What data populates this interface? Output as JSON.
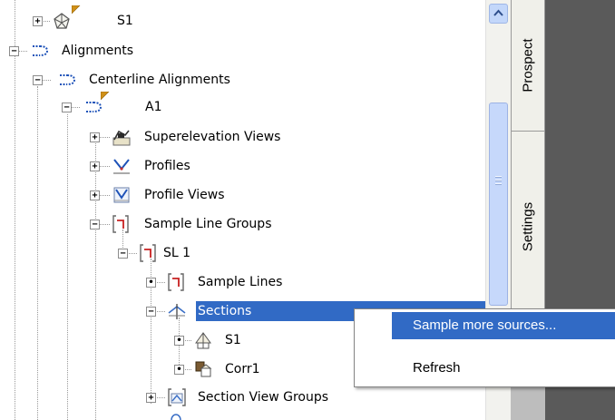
{
  "tree": {
    "items": [
      {
        "label": "S1",
        "icon": "surface-icon",
        "expander": "+"
      },
      {
        "label": "Alignments",
        "icon": "alignment-icon",
        "expander": "−"
      },
      {
        "label": "Centerline Alignments",
        "icon": "alignment-icon",
        "expander": "−"
      },
      {
        "label": "A1",
        "icon": "alignment-icon",
        "expander": "−"
      },
      {
        "label": "Superelevation Views",
        "icon": "superelevation-view-icon",
        "expander": "+"
      },
      {
        "label": "Profiles",
        "icon": "profile-icon",
        "expander": "+"
      },
      {
        "label": "Profile Views",
        "icon": "profile-view-icon",
        "expander": "+"
      },
      {
        "label": "Sample Line Groups",
        "icon": "sample-line-group-icon",
        "expander": "−"
      },
      {
        "label": "SL 1",
        "icon": "sample-line-group-icon",
        "expander": "−"
      },
      {
        "label": "Sample Lines",
        "icon": "sample-line-icon",
        "expander": "•"
      },
      {
        "label": "Sections",
        "icon": "section-icon",
        "expander": "−"
      },
      {
        "label": "S1",
        "icon": "section-surface-icon",
        "expander": "•"
      },
      {
        "label": "Corr1",
        "icon": "section-corridor-icon",
        "expander": "•"
      },
      {
        "label": "Section View Groups",
        "icon": "section-view-group-icon",
        "expander": "+"
      }
    ]
  },
  "tabs": {
    "prospector": "Prospect",
    "settings": "Settings"
  },
  "context_menu": {
    "items": [
      "Sample more sources...",
      "Refresh"
    ]
  },
  "colors": {
    "selection": "#316ac5",
    "warning_flag": "#d09018",
    "scrollbar": "#c6d8fb"
  }
}
